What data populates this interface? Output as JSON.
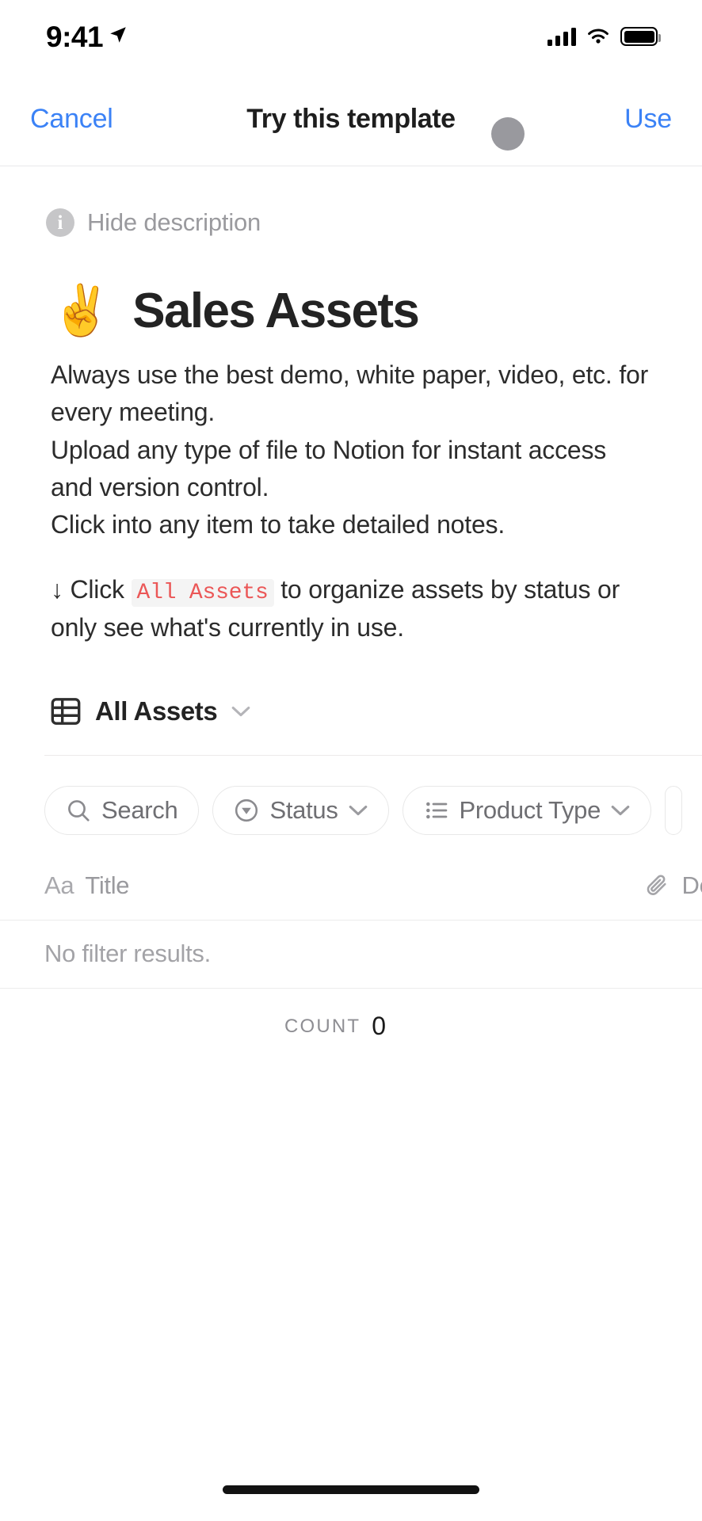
{
  "status_bar": {
    "time": "9:41",
    "location_icon": "location-arrow-icon",
    "cellular_icon": "cellular-signal-icon",
    "wifi_icon": "wifi-icon",
    "battery_icon": "battery-full-icon"
  },
  "nav_bar": {
    "cancel_label": "Cancel",
    "title": "Try this template",
    "use_label": "Use",
    "accent_color": "#3b82f6"
  },
  "description_toggle": {
    "icon": "info-circle-icon",
    "label": "Hide description"
  },
  "page": {
    "emoji": "✌️",
    "title": "Sales Assets",
    "paragraphs": [
      "Always use the best demo, white paper, video, etc. for every meeting.",
      "Upload any type of file to Notion for instant access and version control.",
      "Click into any item to take detailed notes."
    ],
    "callout": {
      "prefix": "↓ Click ",
      "code": "All Assets",
      "suffix": " to organize assets by status or only see what's currently in use.",
      "code_color": "#eb5757",
      "code_background": "#f4f4f4"
    }
  },
  "database": {
    "view_icon": "table-grid-icon",
    "view_name": "All Assets",
    "view_chevron": "chevron-down-icon",
    "chips": [
      {
        "icon": "search-icon",
        "label": "Search",
        "has_chevron": false
      },
      {
        "icon": "status-circle-icon",
        "label": "Status",
        "has_chevron": true
      },
      {
        "icon": "list-icon",
        "label": "Product Type",
        "has_chevron": true
      }
    ],
    "columns": [
      {
        "icon": "title-aa-icon",
        "icon_label": "Aa",
        "label": "Title"
      },
      {
        "icon": "paperclip-icon",
        "icon_label": "",
        "label": "Download"
      }
    ],
    "empty_message": "No filter results.",
    "count_label": "COUNT",
    "count_value": "0"
  },
  "home_indicator": "home-indicator"
}
